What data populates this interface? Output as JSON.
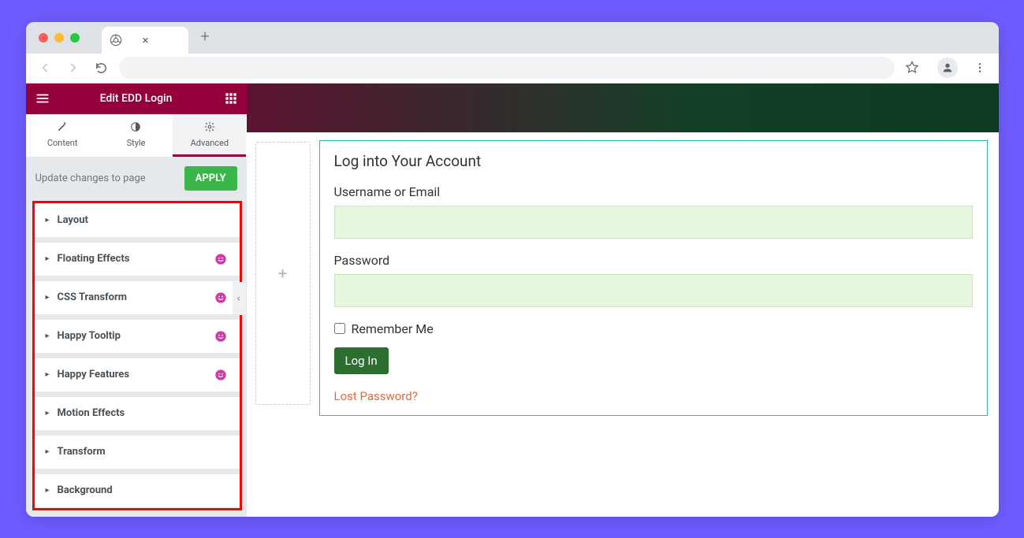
{
  "browser": {
    "addr_value": ""
  },
  "sidebar": {
    "title": "Edit EDD Login",
    "tabs": [
      {
        "label": "Content"
      },
      {
        "label": "Style"
      },
      {
        "label": "Advanced"
      }
    ],
    "update_text": "Update changes to page",
    "apply_label": "APPLY",
    "sections": [
      {
        "label": "Layout",
        "badge": false
      },
      {
        "label": "Floating Effects",
        "badge": true
      },
      {
        "label": "CSS Transform",
        "badge": true
      },
      {
        "label": "Happy Tooltip",
        "badge": true
      },
      {
        "label": "Happy Features",
        "badge": true
      },
      {
        "label": "Motion Effects",
        "badge": false
      },
      {
        "label": "Transform",
        "badge": false
      },
      {
        "label": "Background",
        "badge": false
      }
    ]
  },
  "login": {
    "title": "Log into Your Account",
    "username_label": "Username or Email",
    "password_label": "Password",
    "remember_label": "Remember Me",
    "button_label": "Log In",
    "lost_label": "Lost Password?"
  },
  "drop": {
    "plus": "+"
  }
}
